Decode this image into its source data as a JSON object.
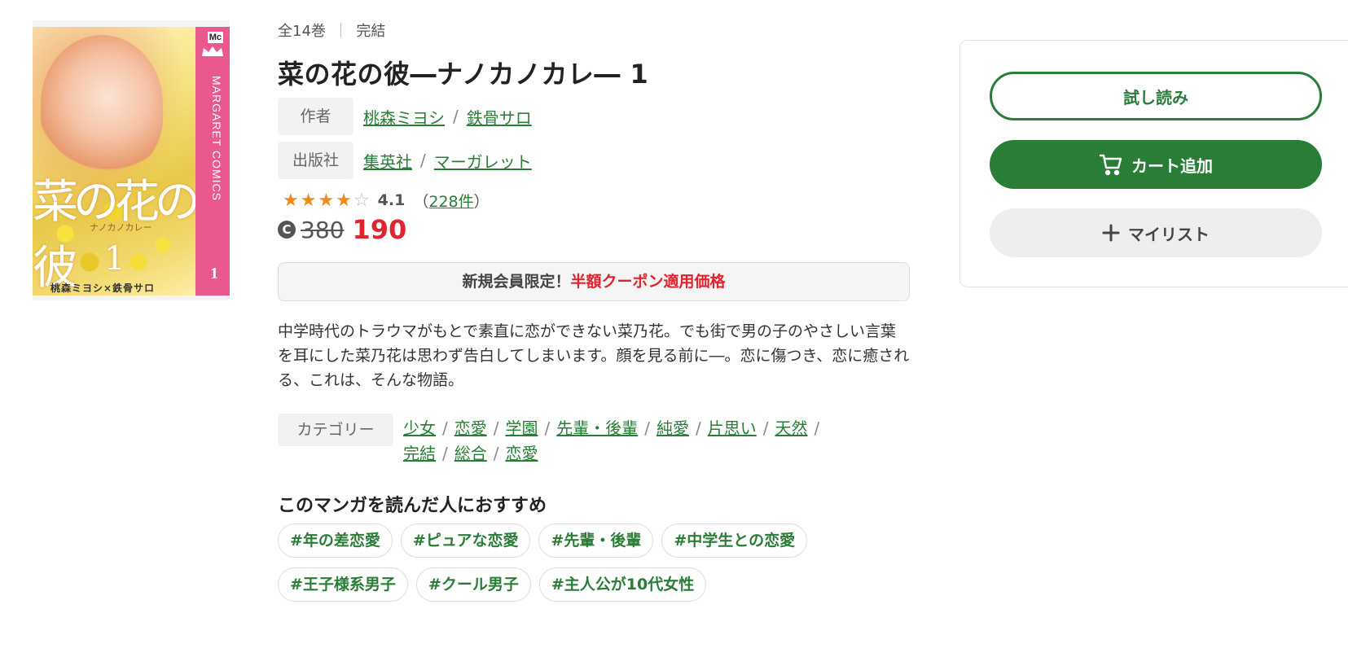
{
  "cover": {
    "logo": "Mc",
    "series": "MARGARET COMICS",
    "volume": "1",
    "title": "菜の花の彼",
    "subtitle": "ナノカノカレー",
    "number": "1",
    "authors": "桃森ミヨシ×鉄骨サロ"
  },
  "meta": {
    "volumes": "全14巻",
    "divider": "｜",
    "status": "完結"
  },
  "title": "菜の花の彼―ナノカノカレ― 1",
  "author": {
    "label": "作者",
    "links": [
      "桃森ミヨシ",
      "鉄骨サロ"
    ],
    "separator": "/"
  },
  "publisher": {
    "label": "出版社",
    "links": [
      "集英社",
      "マーガレット"
    ],
    "separator": "/"
  },
  "rating": {
    "stars": 4,
    "max": 5,
    "value": "4.1",
    "count_open": "（",
    "count": "228件",
    "count_close": "）"
  },
  "price": {
    "coin": "C",
    "original": "380",
    "discounted": "190"
  },
  "coupon": {
    "prefix": "新規会員限定！",
    "highlight": "半額クーポン適用価格"
  },
  "description": "中学時代のトラウマがもとで素直に恋ができない菜乃花。でも街で男の子のやさしい言葉を耳にした菜乃花は思わず告白してしまいます。顔を見る前に―。恋に傷つき、恋に癒される、これは、そんな物語。",
  "categories": {
    "label": "カテゴリー",
    "items": [
      "少女",
      "恋愛",
      "学園",
      "先輩・後輩",
      "純愛",
      "片思い",
      "天然",
      "完結",
      "総合",
      "恋愛"
    ],
    "separator": "/"
  },
  "recommend": {
    "title": "このマンガを読んだ人におすすめ",
    "tags": [
      "#年の差恋愛",
      "#ピュアな恋愛",
      "#先輩・後輩",
      "#中学生との恋愛",
      "#王子様系男子",
      "#クール男子",
      "#主人公が10代女性"
    ]
  },
  "actions": {
    "trial": "試し読み",
    "cart": "カート追加",
    "cart_icon": "cart-icon",
    "mylist": "マイリスト",
    "mylist_icon": "plus-icon"
  },
  "colors": {
    "accent_green": "#2a7d37",
    "price_red": "#e0242e",
    "star_orange": "#f28a1a",
    "cover_pink": "#e9588e"
  }
}
